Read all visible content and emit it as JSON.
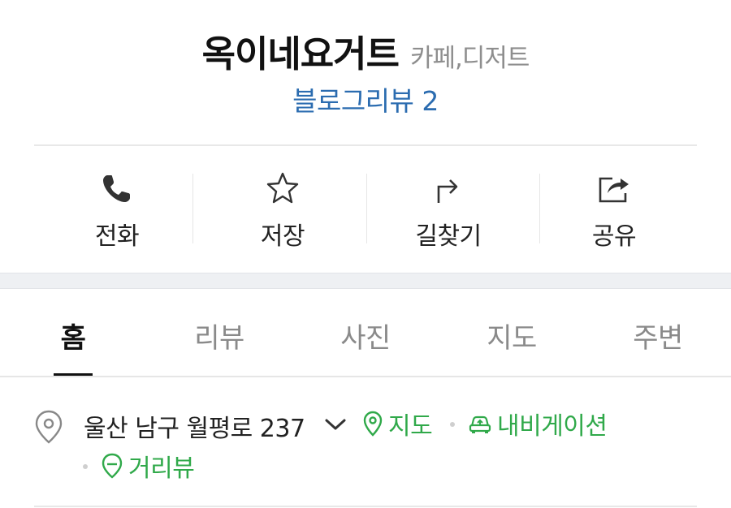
{
  "header": {
    "place_name": "옥이네요거트",
    "category": "카페,디저트",
    "blog_review": "블로그리뷰 2"
  },
  "actions": [
    {
      "label": "전화",
      "icon": "phone-icon"
    },
    {
      "label": "저장",
      "icon": "star-icon"
    },
    {
      "label": "길찾기",
      "icon": "directions-icon"
    },
    {
      "label": "공유",
      "icon": "share-icon"
    }
  ],
  "tabs": [
    {
      "label": "홈",
      "active": true
    },
    {
      "label": "리뷰",
      "active": false
    },
    {
      "label": "사진",
      "active": false
    },
    {
      "label": "지도",
      "active": false
    },
    {
      "label": "주변",
      "active": false
    }
  ],
  "address": {
    "text": "울산 남구 월평로 237",
    "map_label": "지도",
    "navigation_label": "내비게이션",
    "street_view_label": "거리뷰"
  },
  "colors": {
    "accent_blue": "#2b6cb0",
    "link_green": "#30a94a",
    "muted_gray": "#8e8e8e"
  }
}
